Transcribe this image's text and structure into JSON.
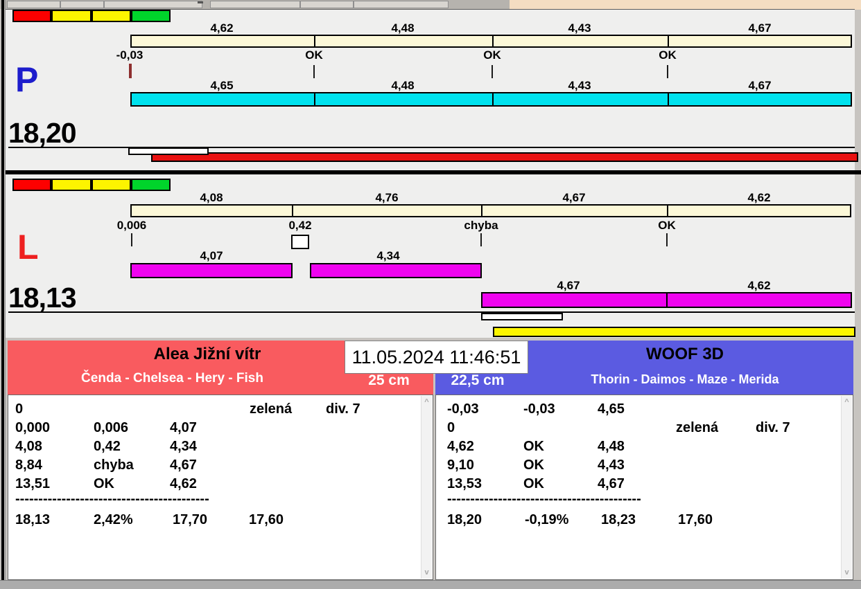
{
  "window": {
    "datetime": "11.05.2024 11:46:51"
  },
  "colors": {
    "lane_background": "#efefee",
    "split_bar_top": "#fcf8d8",
    "split_bar_cyan": "#00e2ee",
    "split_bar_magenta": "#ef04ef",
    "progress_bar_red": "#e91111",
    "progress_bar_yellow": "#fcf500",
    "status_red": "#fd0000",
    "status_yellow": "#fdf400",
    "status_green": "#00d42b",
    "team_left_accent": "#f95b5f",
    "team_right_accent": "#5b5be1",
    "letter_p_color": "#1d1dcc",
    "letter_l_color": "#ee2020",
    "desktop_strip": "#f4ddc2"
  },
  "lane_p": {
    "letter": "P",
    "total": "18,20",
    "top_splits": [
      "4,62",
      "4,48",
      "4,43",
      "4,67"
    ],
    "change_labels": [
      "-0,03",
      "OK",
      "OK",
      "OK"
    ],
    "bottom_splits": [
      "4,65",
      "4,48",
      "4,43",
      "4,67"
    ]
  },
  "lane_l": {
    "letter": "L",
    "total": "18,13",
    "top_splits": [
      "4,08",
      "4,76",
      "4,67",
      "4,62"
    ],
    "change_labels": [
      "0,006",
      "0,42",
      "chyba",
      "OK"
    ],
    "bottom_splits_row1": [
      "4,07",
      "4,34"
    ],
    "bottom_splits_row2": [
      "4,67",
      "4,62"
    ]
  },
  "teams": {
    "left": {
      "name": "Alea Jižní vítr",
      "dogs": "Čenda - Chelsea - Hery - Fish",
      "jump_height": "25 cm",
      "rows": [
        [
          "0",
          "",
          "",
          "zelená",
          "div. 7"
        ],
        [
          "0,000",
          "0,006",
          "4,07",
          "",
          ""
        ],
        [
          "4,08",
          "0,42",
          "4,34",
          "",
          ""
        ],
        [
          "8,84",
          "chyba",
          "4,67",
          "",
          ""
        ],
        [
          "13,51",
          "OK",
          "4,62",
          "",
          ""
        ]
      ],
      "divider": "------------------------------------------",
      "total_row": [
        "18,13",
        "2,42%",
        "17,70",
        "17,60"
      ]
    },
    "right": {
      "name": "WOOF 3D",
      "dogs": "Thorin - Daimos - Maze - Merida",
      "jump_height": "22,5 cm",
      "rows": [
        [
          "-0,03",
          "-0,03",
          "4,65",
          "",
          ""
        ],
        [
          "0",
          "",
          "",
          "zelená",
          "div. 7"
        ],
        [
          "4,62",
          "OK",
          "4,48",
          "",
          ""
        ],
        [
          "9,10",
          "OK",
          "4,43",
          "",
          ""
        ],
        [
          "13,53",
          "OK",
          "4,67",
          "",
          ""
        ]
      ],
      "divider": "------------------------------------------",
      "total_row": [
        "18,20",
        "-0,19%",
        "18,23",
        "17,60"
      ]
    }
  },
  "icons": {
    "scroll_up": "^",
    "scroll_down": "v"
  }
}
